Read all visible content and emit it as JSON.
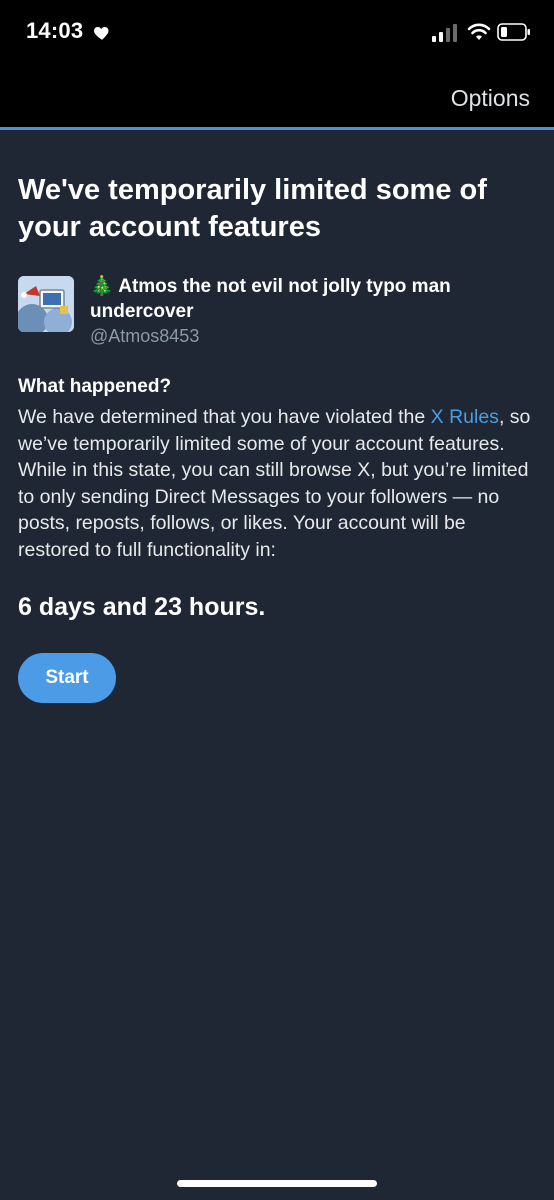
{
  "status_bar": {
    "time": "14:03",
    "icons": [
      "heart-icon",
      "signal-icon",
      "wifi-icon",
      "battery-icon"
    ]
  },
  "nav": {
    "options_label": "Options"
  },
  "page": {
    "title": "We've temporarily limited some of your account features"
  },
  "account": {
    "display_name": "🎄 Atmos the not evil not jolly typo man undercover",
    "handle": "@Atmos8453"
  },
  "notice": {
    "heading": "What happened?",
    "body_before_link": "We have determined that you have violated the ",
    "link_text": "X Rules",
    "body_after_link": ", so we’ve temporarily limited some of your account features. While in this state, you can still browse X, but you’re limited to only sending Direct Messages to your followers — no posts, reposts, follows, or likes. Your account will be restored to full functionality in:",
    "countdown": "6 days and 23 hours."
  },
  "actions": {
    "start_label": "Start"
  },
  "colors": {
    "background": "#1f2734",
    "accent": "#4b9be6",
    "link": "#4a9de0",
    "muted": "#8b98a5"
  }
}
